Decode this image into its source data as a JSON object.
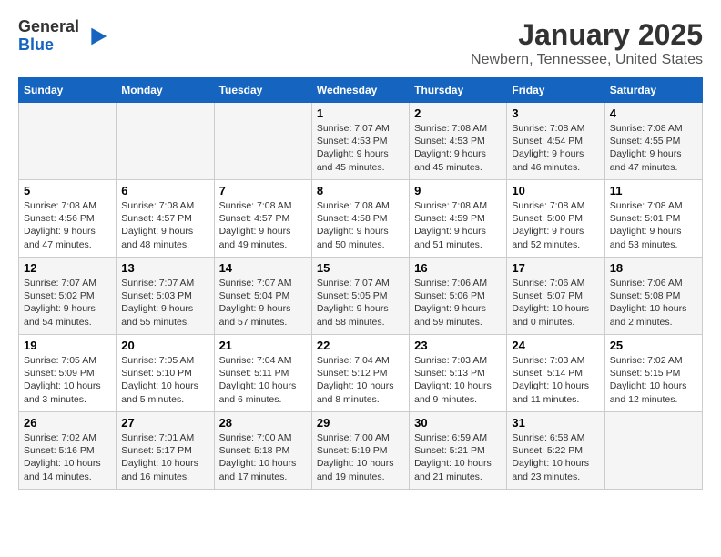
{
  "header": {
    "logo_line1": "General",
    "logo_line2": "Blue",
    "month": "January 2025",
    "location": "Newbern, Tennessee, United States"
  },
  "weekdays": [
    "Sunday",
    "Monday",
    "Tuesday",
    "Wednesday",
    "Thursday",
    "Friday",
    "Saturday"
  ],
  "weeks": [
    [
      {
        "day": "",
        "detail": ""
      },
      {
        "day": "",
        "detail": ""
      },
      {
        "day": "",
        "detail": ""
      },
      {
        "day": "1",
        "detail": "Sunrise: 7:07 AM\nSunset: 4:53 PM\nDaylight: 9 hours and 45 minutes."
      },
      {
        "day": "2",
        "detail": "Sunrise: 7:08 AM\nSunset: 4:53 PM\nDaylight: 9 hours and 45 minutes."
      },
      {
        "day": "3",
        "detail": "Sunrise: 7:08 AM\nSunset: 4:54 PM\nDaylight: 9 hours and 46 minutes."
      },
      {
        "day": "4",
        "detail": "Sunrise: 7:08 AM\nSunset: 4:55 PM\nDaylight: 9 hours and 47 minutes."
      }
    ],
    [
      {
        "day": "5",
        "detail": "Sunrise: 7:08 AM\nSunset: 4:56 PM\nDaylight: 9 hours and 47 minutes."
      },
      {
        "day": "6",
        "detail": "Sunrise: 7:08 AM\nSunset: 4:57 PM\nDaylight: 9 hours and 48 minutes."
      },
      {
        "day": "7",
        "detail": "Sunrise: 7:08 AM\nSunset: 4:57 PM\nDaylight: 9 hours and 49 minutes."
      },
      {
        "day": "8",
        "detail": "Sunrise: 7:08 AM\nSunset: 4:58 PM\nDaylight: 9 hours and 50 minutes."
      },
      {
        "day": "9",
        "detail": "Sunrise: 7:08 AM\nSunset: 4:59 PM\nDaylight: 9 hours and 51 minutes."
      },
      {
        "day": "10",
        "detail": "Sunrise: 7:08 AM\nSunset: 5:00 PM\nDaylight: 9 hours and 52 minutes."
      },
      {
        "day": "11",
        "detail": "Sunrise: 7:08 AM\nSunset: 5:01 PM\nDaylight: 9 hours and 53 minutes."
      }
    ],
    [
      {
        "day": "12",
        "detail": "Sunrise: 7:07 AM\nSunset: 5:02 PM\nDaylight: 9 hours and 54 minutes."
      },
      {
        "day": "13",
        "detail": "Sunrise: 7:07 AM\nSunset: 5:03 PM\nDaylight: 9 hours and 55 minutes."
      },
      {
        "day": "14",
        "detail": "Sunrise: 7:07 AM\nSunset: 5:04 PM\nDaylight: 9 hours and 57 minutes."
      },
      {
        "day": "15",
        "detail": "Sunrise: 7:07 AM\nSunset: 5:05 PM\nDaylight: 9 hours and 58 minutes."
      },
      {
        "day": "16",
        "detail": "Sunrise: 7:06 AM\nSunset: 5:06 PM\nDaylight: 9 hours and 59 minutes."
      },
      {
        "day": "17",
        "detail": "Sunrise: 7:06 AM\nSunset: 5:07 PM\nDaylight: 10 hours and 0 minutes."
      },
      {
        "day": "18",
        "detail": "Sunrise: 7:06 AM\nSunset: 5:08 PM\nDaylight: 10 hours and 2 minutes."
      }
    ],
    [
      {
        "day": "19",
        "detail": "Sunrise: 7:05 AM\nSunset: 5:09 PM\nDaylight: 10 hours and 3 minutes."
      },
      {
        "day": "20",
        "detail": "Sunrise: 7:05 AM\nSunset: 5:10 PM\nDaylight: 10 hours and 5 minutes."
      },
      {
        "day": "21",
        "detail": "Sunrise: 7:04 AM\nSunset: 5:11 PM\nDaylight: 10 hours and 6 minutes."
      },
      {
        "day": "22",
        "detail": "Sunrise: 7:04 AM\nSunset: 5:12 PM\nDaylight: 10 hours and 8 minutes."
      },
      {
        "day": "23",
        "detail": "Sunrise: 7:03 AM\nSunset: 5:13 PM\nDaylight: 10 hours and 9 minutes."
      },
      {
        "day": "24",
        "detail": "Sunrise: 7:03 AM\nSunset: 5:14 PM\nDaylight: 10 hours and 11 minutes."
      },
      {
        "day": "25",
        "detail": "Sunrise: 7:02 AM\nSunset: 5:15 PM\nDaylight: 10 hours and 12 minutes."
      }
    ],
    [
      {
        "day": "26",
        "detail": "Sunrise: 7:02 AM\nSunset: 5:16 PM\nDaylight: 10 hours and 14 minutes."
      },
      {
        "day": "27",
        "detail": "Sunrise: 7:01 AM\nSunset: 5:17 PM\nDaylight: 10 hours and 16 minutes."
      },
      {
        "day": "28",
        "detail": "Sunrise: 7:00 AM\nSunset: 5:18 PM\nDaylight: 10 hours and 17 minutes."
      },
      {
        "day": "29",
        "detail": "Sunrise: 7:00 AM\nSunset: 5:19 PM\nDaylight: 10 hours and 19 minutes."
      },
      {
        "day": "30",
        "detail": "Sunrise: 6:59 AM\nSunset: 5:21 PM\nDaylight: 10 hours and 21 minutes."
      },
      {
        "day": "31",
        "detail": "Sunrise: 6:58 AM\nSunset: 5:22 PM\nDaylight: 10 hours and 23 minutes."
      },
      {
        "day": "",
        "detail": ""
      }
    ]
  ]
}
